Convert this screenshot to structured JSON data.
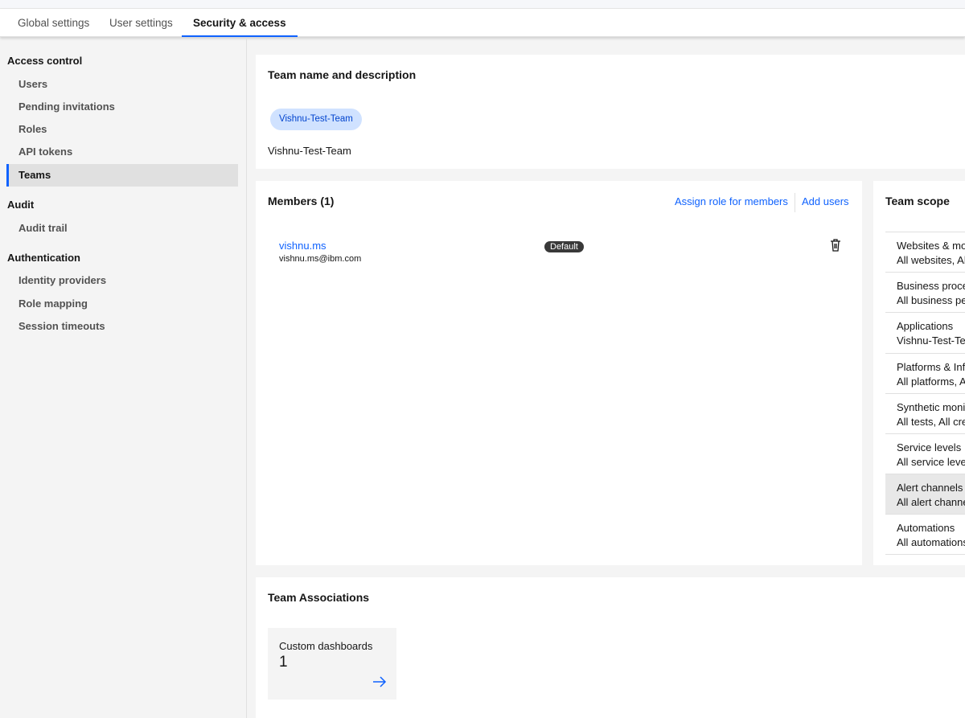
{
  "tabs": [
    "Global settings",
    "User settings",
    "Security & access"
  ],
  "sidebar": {
    "sections": [
      {
        "title": "Access control",
        "items": [
          "Users",
          "Pending invitations",
          "Roles",
          "API tokens",
          "Teams"
        ]
      },
      {
        "title": "Audit",
        "items": [
          "Audit trail"
        ]
      },
      {
        "title": "Authentication",
        "items": [
          "Identity providers",
          "Role mapping",
          "Session timeouts"
        ]
      }
    ],
    "active": "Teams"
  },
  "team": {
    "heading": "Team name and description",
    "tag": "Vishnu-Test-Team",
    "name": "Vishnu-Test-Team"
  },
  "members": {
    "heading": "Members (1)",
    "assign_role": "Assign role for members",
    "add_users": "Add users",
    "list": [
      {
        "name": "vishnu.ms",
        "email": "vishnu.ms@ibm.com",
        "badge": "Default"
      }
    ]
  },
  "scope": {
    "heading": "Team scope",
    "items": [
      {
        "title": "Websites & mo",
        "value": "All websites, Al"
      },
      {
        "title": "Business proce",
        "value": "All business pe"
      },
      {
        "title": "Applications",
        "value": "Vishnu-Test-Te"
      },
      {
        "title": "Platforms & Inf",
        "value": "All platforms, A"
      },
      {
        "title": "Synthetic moni",
        "value": "All tests, All cre"
      },
      {
        "title": "Service levels",
        "value": "All service leve"
      },
      {
        "title": "Alert channels",
        "value": "All alert channe"
      },
      {
        "title": "Automations",
        "value": "All automations"
      }
    ]
  },
  "associations": {
    "heading": "Team Associations",
    "tiles": [
      {
        "label": "Custom dashboards",
        "count": "1"
      }
    ]
  }
}
